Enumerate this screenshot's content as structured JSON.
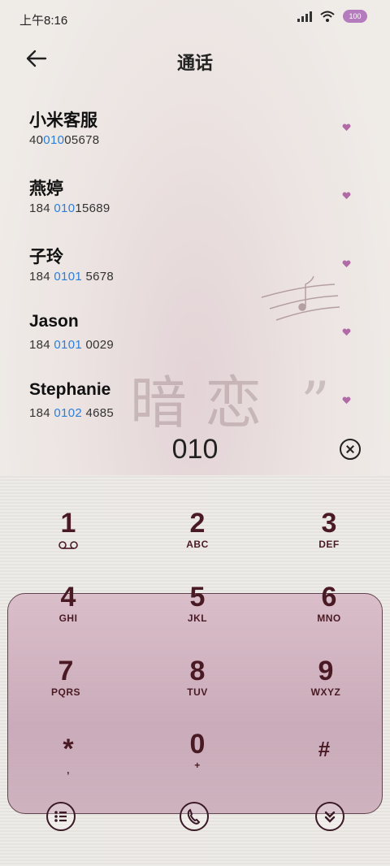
{
  "status": {
    "time": "上午8:16",
    "battery": "100"
  },
  "header": {
    "title": "通话"
  },
  "contacts": [
    {
      "name": "小米客服",
      "number_pre": "40",
      "number_hl": "010",
      "number_post": "05678"
    },
    {
      "name": "燕婷",
      "number_pre": "184 ",
      "number_hl": "010",
      "number_post": "15689"
    },
    {
      "name": "子玲",
      "number_pre": "184 ",
      "number_hl": "0101",
      "number_post": " 5678"
    },
    {
      "name": "Jason",
      "number_pre": "184 ",
      "number_hl": "0101",
      "number_post": " 0029"
    },
    {
      "name": "Stephanie",
      "number_pre": "184 ",
      "number_hl": "0102",
      "number_post": " 4685"
    }
  ],
  "dial": {
    "digits": "010"
  },
  "keys": [
    {
      "num": "1",
      "letters": ""
    },
    {
      "num": "2",
      "letters": "ABC"
    },
    {
      "num": "3",
      "letters": "DEF"
    },
    {
      "num": "4",
      "letters": "GHI"
    },
    {
      "num": "5",
      "letters": "JKL"
    },
    {
      "num": "6",
      "letters": "MNO"
    },
    {
      "num": "7",
      "letters": "PQRS"
    },
    {
      "num": "8",
      "letters": "TUV"
    },
    {
      "num": "9",
      "letters": "WXYZ"
    },
    {
      "num": "*",
      "letters": ","
    },
    {
      "num": "0",
      "letters": "+"
    },
    {
      "num": "#",
      "letters": ""
    }
  ],
  "icons": {
    "back": "arrow-left-icon",
    "clear": "close-circle-icon",
    "menu": "list-icon",
    "call": "phone-icon",
    "collapse": "chevrons-down-icon"
  },
  "colors": {
    "highlight": "#2b7fd8",
    "heart": "#b06aa6",
    "key_text": "#4a1a24"
  }
}
